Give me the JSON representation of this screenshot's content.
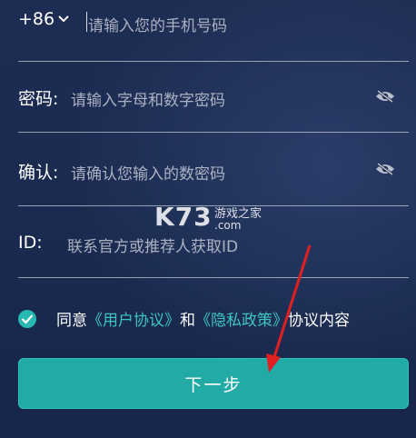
{
  "phone": {
    "country_code": "+86",
    "placeholder": "请输入您的手机号码"
  },
  "password": {
    "label": "密码:",
    "placeholder": "请输入字母和数字密码",
    "toggle_icon": "eye-off-icon"
  },
  "confirm": {
    "label": "确认:",
    "placeholder": "请确认您输入的数密码",
    "toggle_icon": "eye-off-icon"
  },
  "id_field": {
    "label": "ID:",
    "placeholder": "联系官方或推荐人获取ID"
  },
  "agreement": {
    "prefix": "同意",
    "user_agreement": "《用户协议》",
    "and": "和",
    "privacy_policy": "《隐私政策》",
    "suffix": "协议内容",
    "checked": true
  },
  "next_button": {
    "label": "下一步"
  },
  "watermark": {
    "logo": "K73",
    "site_name": "游戏之家",
    "domain": ".com"
  },
  "colors": {
    "background": "#1c2b4e",
    "accent": "#22aaa6",
    "link": "#3ec5c0",
    "annotation_arrow": "#e02020"
  }
}
